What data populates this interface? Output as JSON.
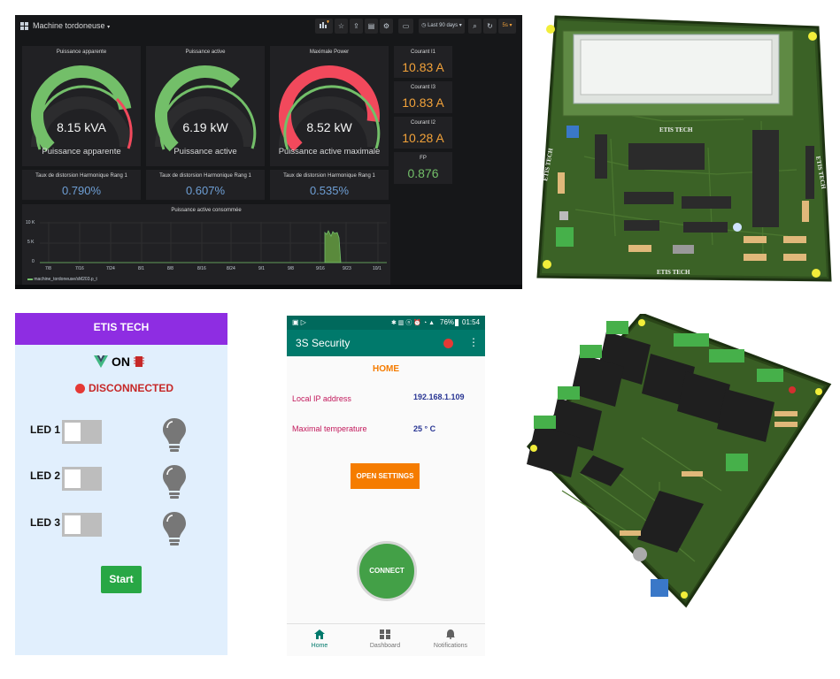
{
  "grafana": {
    "dashboard_title": "Machine tordoneuse",
    "dashboard_caret": "▾",
    "time_range": "Last 90 days",
    "refresh": "5s",
    "gauges": [
      {
        "title": "Puissance apparente",
        "value": "8.15 kVA",
        "label": "Puissance apparente",
        "color": "#73bf69",
        "fraction": 0.8
      },
      {
        "title": "Puissance active",
        "value": "6.19 kW",
        "label": "Puissance active",
        "color": "#73bf69",
        "fraction": 0.66
      },
      {
        "title": "Maximale Power",
        "value": "8.52 kW",
        "label": "Puissance active maximale",
        "color": "#f2495c",
        "fraction": 0.86
      }
    ],
    "thd": [
      {
        "title": "Taux de distorsion Harmonique Rang 1",
        "value": "0.790%"
      },
      {
        "title": "Taux de distorsion Harmonique Rang 1",
        "value": "0.607%"
      },
      {
        "title": "Taux de distorsion Harmonique Rang 1",
        "value": "0.535%"
      }
    ],
    "currents": [
      {
        "title": "Courant I1",
        "value": "10.83 A"
      },
      {
        "title": "Courant I3",
        "value": "10.83 A"
      },
      {
        "title": "Courant I2",
        "value": "10.28 A"
      }
    ],
    "fp": {
      "title": "FP",
      "value": "0.876",
      "color": "#73bf69"
    },
    "graph": {
      "title": "Puissance active consommée",
      "y_ticks": [
        "10 K",
        "5 K",
        "0"
      ],
      "x_ticks": [
        "7/8",
        "7/16",
        "7/24",
        "8/1",
        "8/8",
        "8/16",
        "8/24",
        "9/1",
        "9/8",
        "9/16",
        "9/23",
        "10/1"
      ],
      "legend": "machine_tordoneuse/sM203.p_t"
    }
  },
  "etis_app": {
    "header": "ETIS TECH",
    "on_label": "ON",
    "disconnected_label": "DISCONNECTED",
    "leds": [
      {
        "label": "LED 1",
        "state": "off"
      },
      {
        "label": "LED 2",
        "state": "off"
      },
      {
        "label": "LED 3",
        "state": "off"
      }
    ],
    "start_label": "Start",
    "colors": {
      "header": "#8e2de2",
      "start": "#28a745",
      "status_dot": "#e53935"
    }
  },
  "phone": {
    "battery": "76%",
    "time": "01:54",
    "app_title": "3S Security",
    "section_title": "HOME",
    "rows": [
      {
        "label": "Local IP address",
        "value": "192.168.1.109"
      },
      {
        "label": "Maximal temperature",
        "value": "25 ° C"
      }
    ],
    "settings_button": "OPEN SETTINGS",
    "connect_button": "CONNECT",
    "nav": [
      {
        "label": "Home",
        "icon": "home-icon",
        "active": true
      },
      {
        "label": "Dashboard",
        "icon": "dashboard-icon",
        "active": false
      },
      {
        "label": "Notifications",
        "icon": "bell-icon",
        "active": false
      }
    ],
    "colors": {
      "appbar": "#00796b",
      "label": "#c2185b",
      "value": "#283593",
      "settings": "#f57c00",
      "connect": "#43a047"
    }
  },
  "pcb_top": {
    "silkscreen": [
      "ETIS TECH",
      "ETIS TECH",
      "ETIS TECH",
      "ETIS TECH"
    ]
  }
}
